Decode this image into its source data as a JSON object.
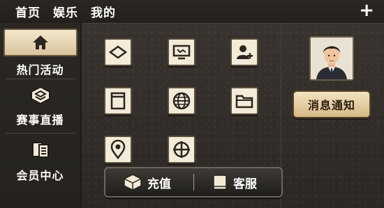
{
  "topbar": {
    "nav": [
      "首页",
      "娱乐",
      "我的"
    ],
    "plus_icon": "plus-icon"
  },
  "sidebar": {
    "items": [
      {
        "label": "热门活动",
        "icon": "home-icon",
        "active": true
      },
      {
        "label": "赛事直播",
        "icon": "layers-icon",
        "active": false
      },
      {
        "label": "会员中心",
        "icon": "document-icon",
        "active": false
      }
    ]
  },
  "grid": {
    "icons": [
      "diamond-icon",
      "monitor-icon",
      "add-user-icon",
      "window-icon",
      "globe-icon",
      "folder-icon",
      "location-pin-icon",
      "crosshair-icon"
    ]
  },
  "right_panel": {
    "avatar": "avatar",
    "notify_label": "消息通知"
  },
  "bottombar": {
    "recharge_label": "充值",
    "service_label": "客服",
    "recharge_icon": "box-icon",
    "service_icon": "book-icon"
  },
  "colors": {
    "tile_bg": "#f3ead7",
    "button_gold": "#d6b886",
    "background": "#2f2b27"
  }
}
